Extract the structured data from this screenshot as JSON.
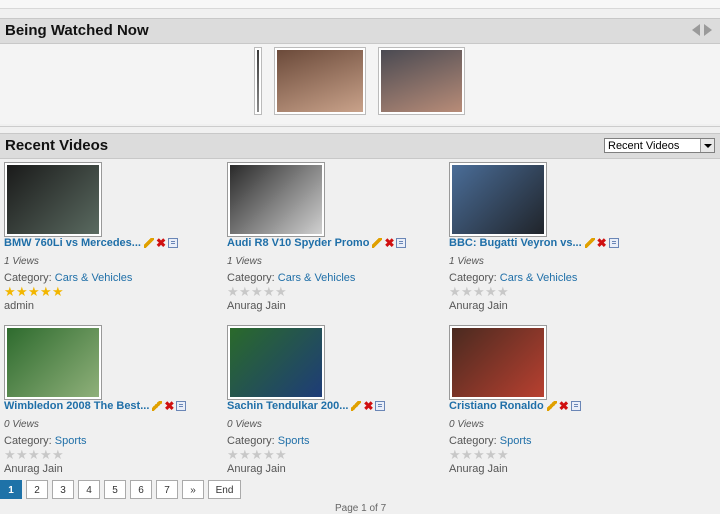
{
  "being_watched": {
    "title": "Being Watched Now",
    "thumbs": [
      {
        "name": "partial-video-thumbnail",
        "colors": [
          "#3a3a3a",
          "#8a8a8a"
        ]
      },
      {
        "name": "girl-singing-thumbnail",
        "colors": [
          "#6b4a3a",
          "#c9a28a"
        ]
      },
      {
        "name": "man-face-thumbnail",
        "colors": [
          "#4a4a52",
          "#b88c78"
        ]
      }
    ]
  },
  "recent": {
    "title": "Recent Videos",
    "select_value": "Recent Videos",
    "videos": [
      {
        "title": "BMW 760Li vs Mercedes...",
        "views": "1 Views",
        "category_label": "Category:",
        "category": "Cars & Vehicles",
        "rating": 5,
        "author": "admin",
        "thumb": [
          "#1a1a1a",
          "#5a6a60"
        ]
      },
      {
        "title": "Audi R8 V10 Spyder Promo",
        "views": "1 Views",
        "category_label": "Category:",
        "category": "Cars & Vehicles",
        "rating": 0,
        "author": "Anurag Jain",
        "thumb": [
          "#2a2a2a",
          "#d0d0d0"
        ]
      },
      {
        "title": "BBC: Bugatti Veyron vs...",
        "views": "1 Views",
        "category_label": "Category:",
        "category": "Cars & Vehicles",
        "rating": 0,
        "author": "Anurag Jain",
        "thumb": [
          "#4a6d98",
          "#20242a"
        ]
      },
      {
        "title": "Wimbledon 2008 The Best...",
        "views": "0 Views",
        "category_label": "Category:",
        "category": "Sports",
        "rating": 0,
        "author": "Anurag Jain",
        "thumb": [
          "#2e6b2e",
          "#8fb07a"
        ]
      },
      {
        "title": "Sachin Tendulkar 200...",
        "views": "0 Views",
        "category_label": "Category:",
        "category": "Sports",
        "rating": 0,
        "author": "Anurag Jain",
        "thumb": [
          "#2a6a2a",
          "#1e3c78"
        ]
      },
      {
        "title": "Cristiano Ronaldo",
        "views": "0 Views",
        "category_label": "Category:",
        "category": "Sports",
        "rating": 0,
        "author": "Anurag Jain",
        "thumb": [
          "#4a2a20",
          "#b84030"
        ]
      }
    ]
  },
  "pager": {
    "pages": [
      "1",
      "2",
      "3",
      "4",
      "5",
      "6",
      "7",
      "»",
      "End"
    ],
    "current": "1",
    "info": "Page 1 of 7"
  },
  "colors": {
    "link": "#1f6fa8",
    "pager_active": "#1e72a8",
    "star_on": "#f2b600",
    "star_off": "#c8c8c8"
  }
}
